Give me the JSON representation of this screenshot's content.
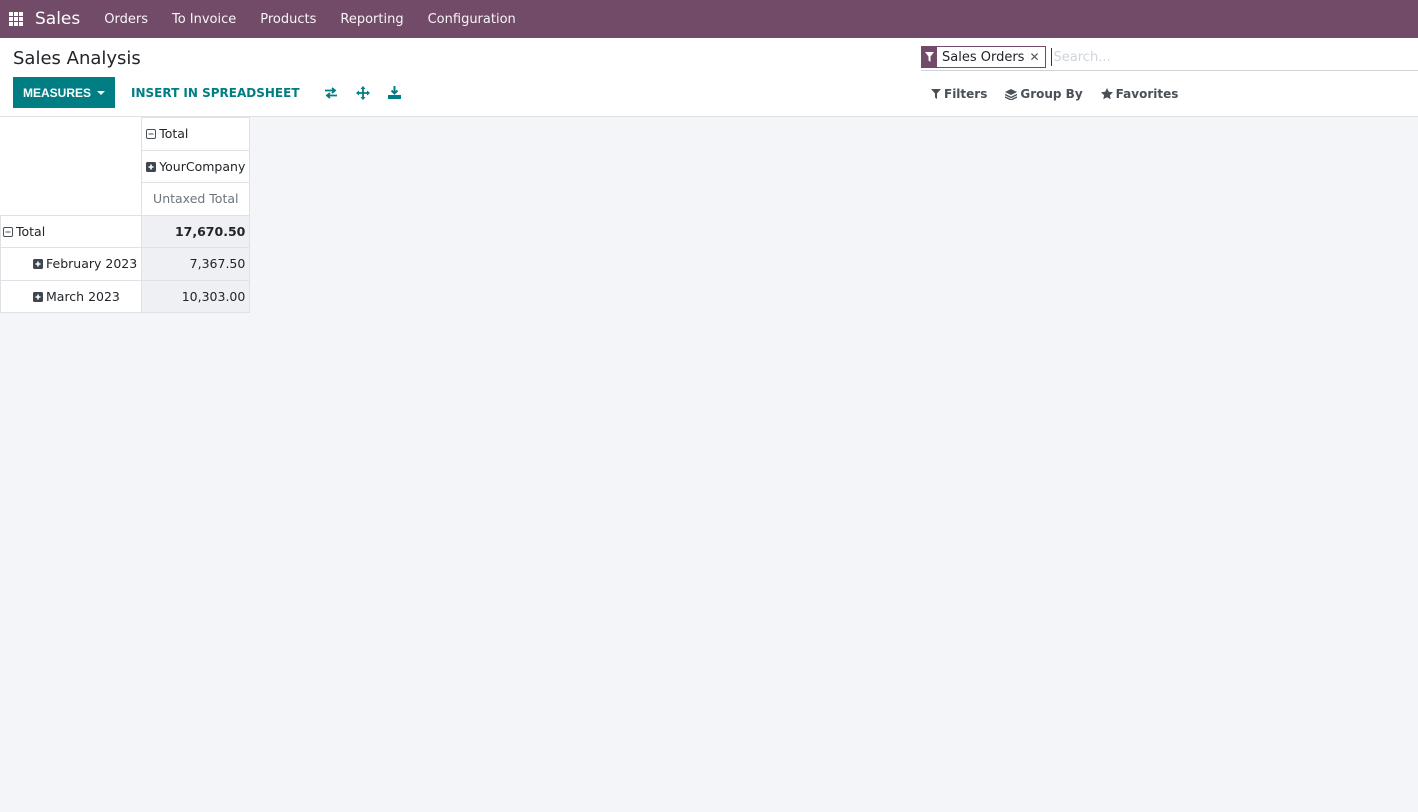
{
  "navbar": {
    "app_name": "Sales",
    "menu": [
      "Orders",
      "To Invoice",
      "Products",
      "Reporting",
      "Configuration"
    ],
    "apps_icon": "grid-icon",
    "color": "#714b67"
  },
  "control_panel": {
    "title": "Sales Analysis",
    "measures_label": "MEASURES",
    "insert_label": "INSERT IN SPREADSHEET",
    "icons": [
      "flip-axis-icon",
      "expand-all-icon",
      "download-icon"
    ],
    "accent": "#017e84"
  },
  "search": {
    "facet_label": "Sales Orders",
    "facet_icon": "filter-icon",
    "placeholder": "Search...",
    "filters_label": "Filters",
    "group_by_label": "Group By",
    "favorites_label": "Favorites"
  },
  "pivot": {
    "col_header_total": "Total",
    "col_header_group": "YourCompany",
    "measure": "Untaxed Total",
    "rows": [
      {
        "label": "Total",
        "value": "17,670.50",
        "level": 0,
        "expanded": true
      },
      {
        "label": "February 2023",
        "value": "7,367.50",
        "level": 1,
        "expanded": false
      },
      {
        "label": "March 2023",
        "value": "10,303.00",
        "level": 1,
        "expanded": false
      }
    ]
  }
}
